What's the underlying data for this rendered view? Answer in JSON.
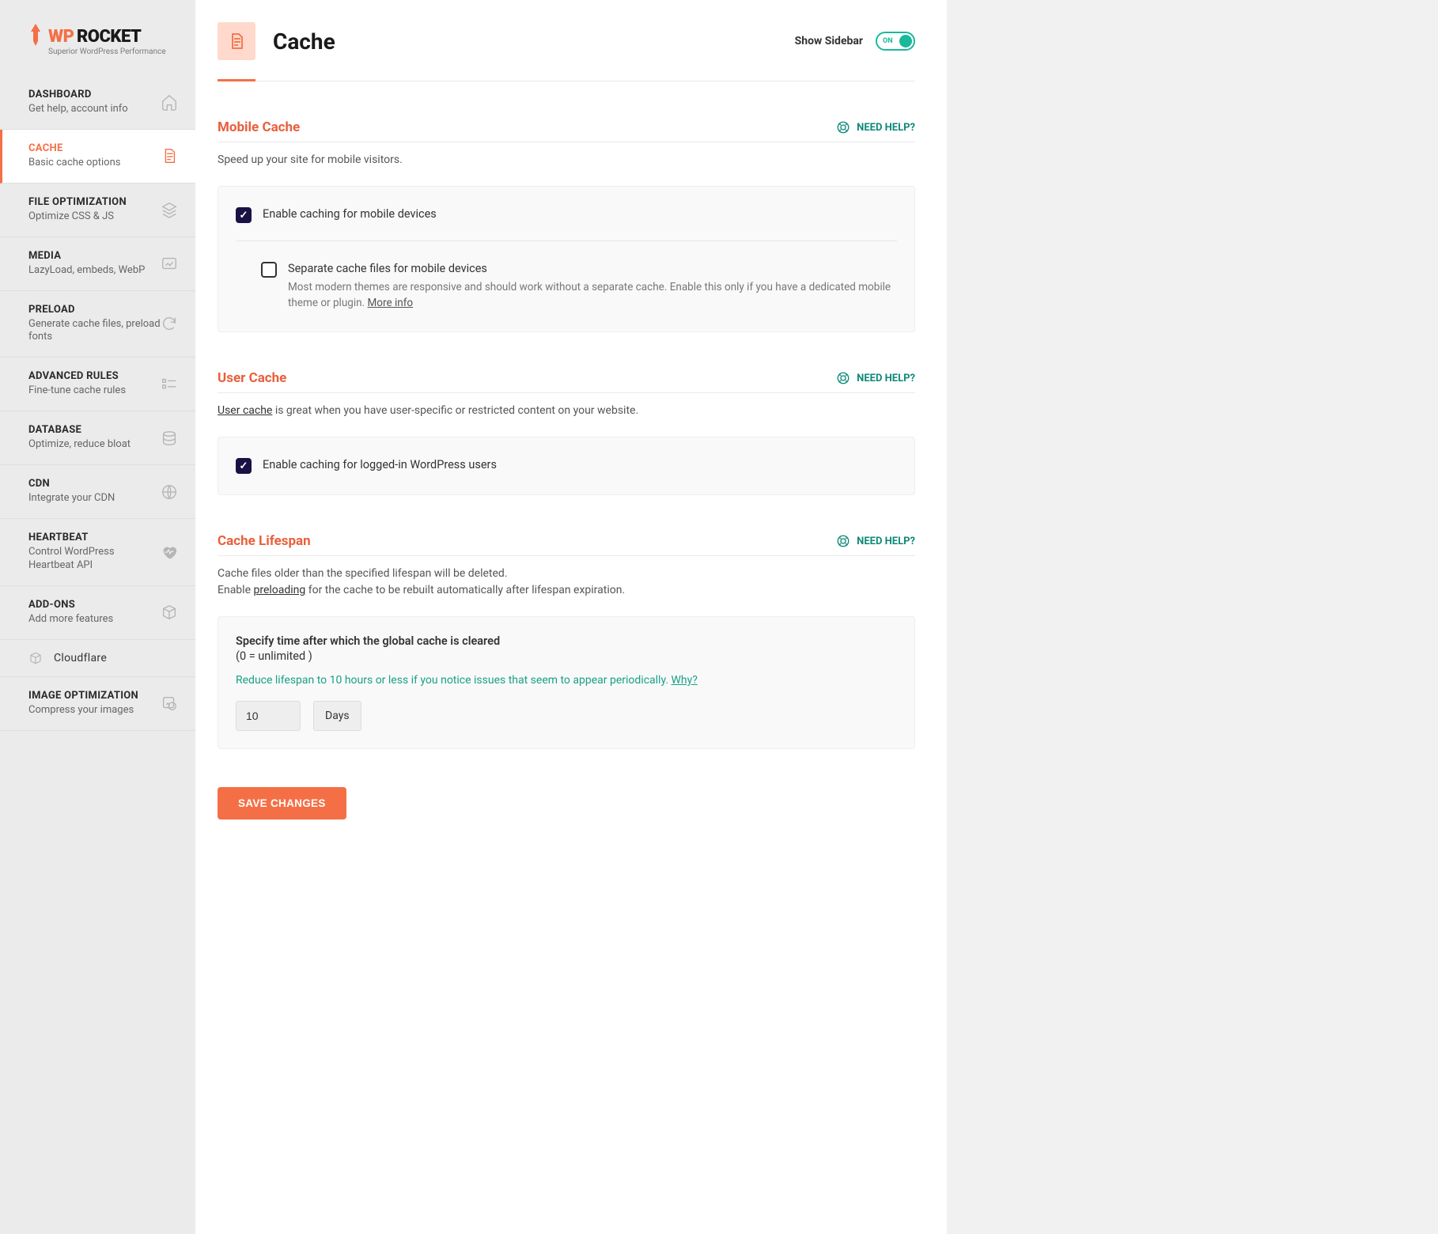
{
  "logo": {
    "wp": "WP",
    "rocket": "ROCKET",
    "tagline": "Superior WordPress Performance"
  },
  "sidebar": {
    "items": [
      {
        "title": "DASHBOARD",
        "sub": "Get help, account info"
      },
      {
        "title": "CACHE",
        "sub": "Basic cache options"
      },
      {
        "title": "FILE OPTIMIZATION",
        "sub": "Optimize CSS & JS"
      },
      {
        "title": "MEDIA",
        "sub": "LazyLoad, embeds, WebP"
      },
      {
        "title": "PRELOAD",
        "sub": "Generate cache files, preload fonts"
      },
      {
        "title": "ADVANCED RULES",
        "sub": "Fine-tune cache rules"
      },
      {
        "title": "DATABASE",
        "sub": "Optimize, reduce bloat"
      },
      {
        "title": "CDN",
        "sub": "Integrate your CDN"
      },
      {
        "title": "HEARTBEAT",
        "sub": "Control WordPress Heartbeat API"
      },
      {
        "title": "ADD-ONS",
        "sub": "Add more features"
      }
    ],
    "sub_items": [
      {
        "title": "Cloudflare"
      }
    ],
    "bottom": [
      {
        "title": "IMAGE OPTIMIZATION",
        "sub": "Compress your images"
      }
    ]
  },
  "header": {
    "title": "Cache",
    "show_sidebar": "Show Sidebar",
    "toggle": "ON"
  },
  "need_help": "NEED HELP?",
  "sections": {
    "mobile": {
      "title": "Mobile Cache",
      "desc": "Speed up your site for mobile visitors.",
      "opt1": "Enable caching for mobile devices",
      "opt2_label": "Separate cache files for mobile devices",
      "opt2_desc": "Most modern themes are responsive and should work without a separate cache. Enable this only if you have a dedicated mobile theme or plugin. ",
      "opt2_more": "More info"
    },
    "user": {
      "title": "User Cache",
      "desc_link": "User cache",
      "desc_rest": " is great when you have user-specific or restricted content on your website.",
      "opt1": "Enable caching for logged-in WordPress users"
    },
    "lifespan": {
      "title": "Cache Lifespan",
      "desc1": "Cache files older than the specified lifespan will be deleted.",
      "desc2a": "Enable ",
      "desc2_link": "preloading",
      "desc2b": " for the cache to be rebuilt automatically after lifespan expiration.",
      "box_title": "Specify time after which the global cache is cleared",
      "box_sub": "(0 = unlimited )",
      "tip": "Reduce lifespan to 10 hours or less if you notice issues that seem to appear periodically. ",
      "tip_link": "Why?",
      "value": "10",
      "unit": "Days"
    }
  },
  "save": "SAVE CHANGES"
}
